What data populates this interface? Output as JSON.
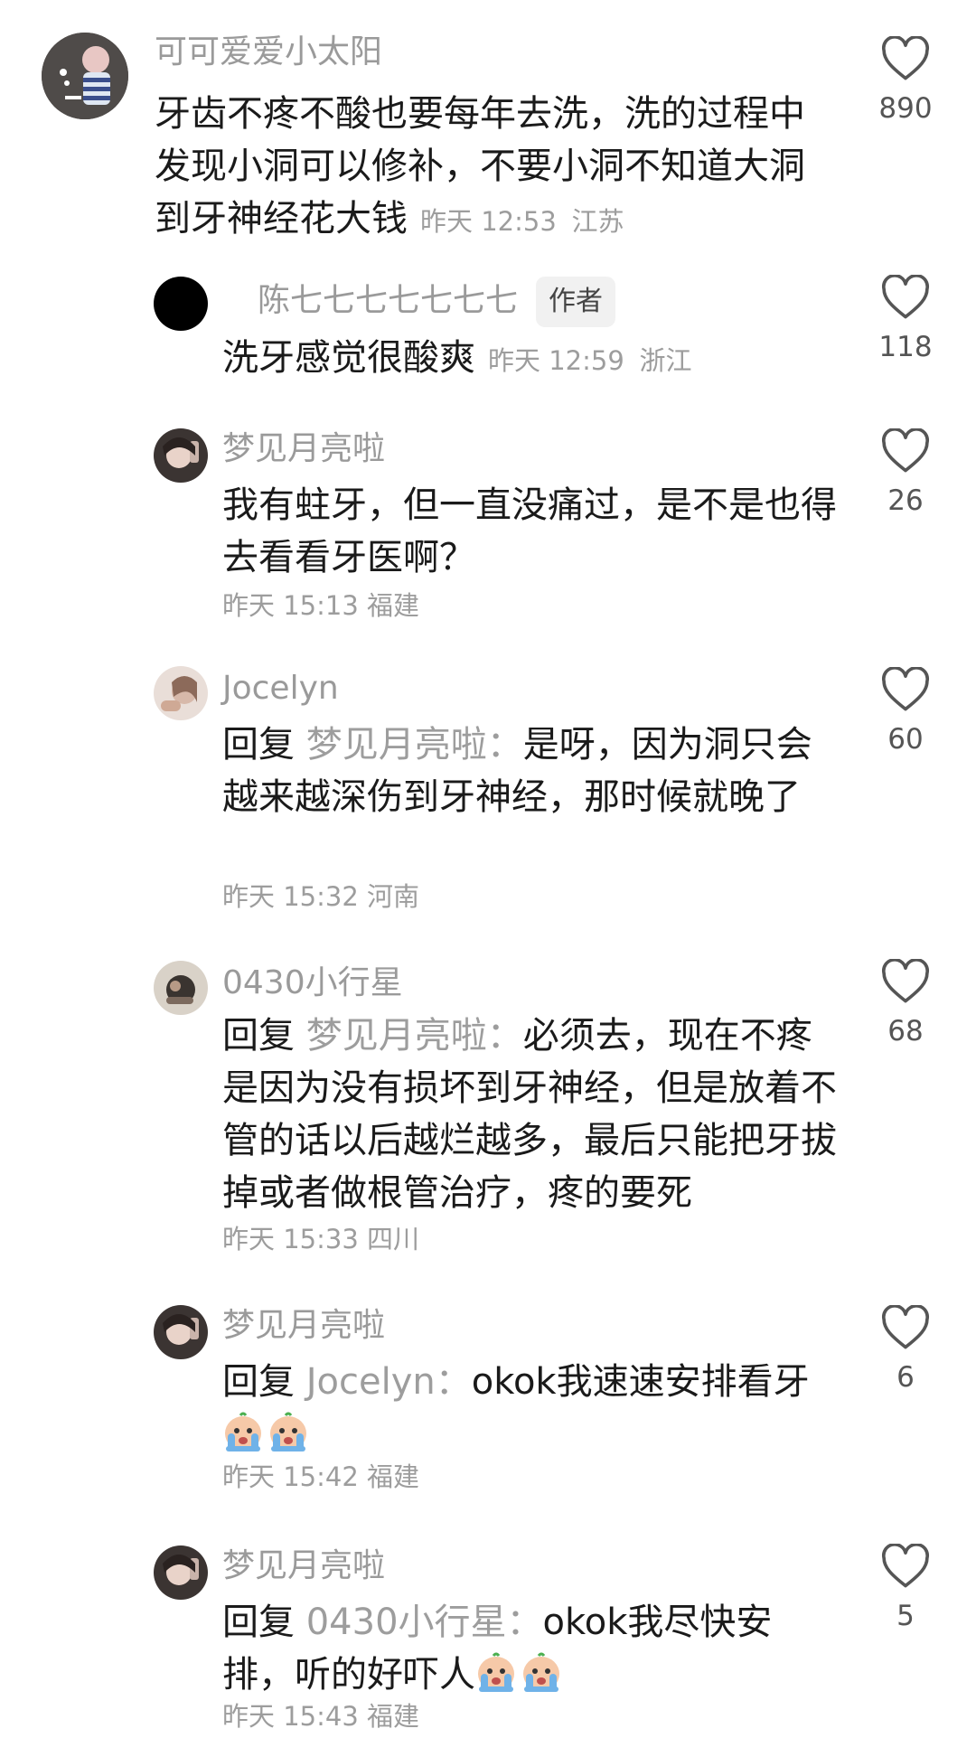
{
  "comments": [
    {
      "username": "可可爱爱小太阳",
      "text": "牙齿不疼不酸也要每年去洗，洗的过程中发现小洞可以修补，不要小洞不知道大洞到牙神经花大钱",
      "time": "昨天 12:53",
      "location": "江苏",
      "likes": "890"
    },
    {
      "username": "陈七七七七七七七",
      "author_tag": "作者",
      "text": "洗牙感觉很酸爽",
      "time": "昨天 12:59",
      "location": "浙江",
      "likes": "118"
    },
    {
      "username": "梦见月亮啦",
      "text": "我有蛀牙，但一直没痛过，是不是也得去看看牙医啊？",
      "time": "昨天 15:13",
      "location": "福建",
      "likes": "26"
    },
    {
      "username": "Jocelyn",
      "reply_prefix": "回复",
      "reply_to": "梦见月亮啦：",
      "text": "是呀，因为洞只会越来越深伤到牙神经，那时候就晚了",
      "time": "昨天 15:32",
      "location": "河南",
      "likes": "60"
    },
    {
      "username": "0430小行星",
      "reply_prefix": "回复",
      "reply_to": "梦见月亮啦：",
      "text": "必须去，现在不疼是因为没有损坏到牙神经，但是放着不管的话以后越烂越多，最后只能把牙拔掉或者做根管治疗，疼的要死",
      "time": "昨天 15:33",
      "location": "四川",
      "likes": "68"
    },
    {
      "username": "梦见月亮啦",
      "reply_prefix": "回复",
      "reply_to": "Jocelyn：",
      "text": "okok我速速安排看牙",
      "emojis": [
        "crying-face-emoji",
        "crying-face-emoji"
      ],
      "time": "昨天 15:42",
      "location": "福建",
      "likes": "6"
    },
    {
      "username": "梦见月亮啦",
      "reply_prefix": "回复",
      "reply_to": "0430小行星：",
      "text": "okok我尽快安排，听的好吓人",
      "emojis": [
        "crying-face-emoji",
        "crying-face-emoji"
      ],
      "time": "昨天 15:43",
      "location": "福建",
      "likes": "5"
    }
  ],
  "icons": {
    "like": "heart-outline-icon"
  },
  "colors": {
    "username": "#9a9a9a",
    "text": "#1a1a1a",
    "meta": "#9d9d9d"
  }
}
